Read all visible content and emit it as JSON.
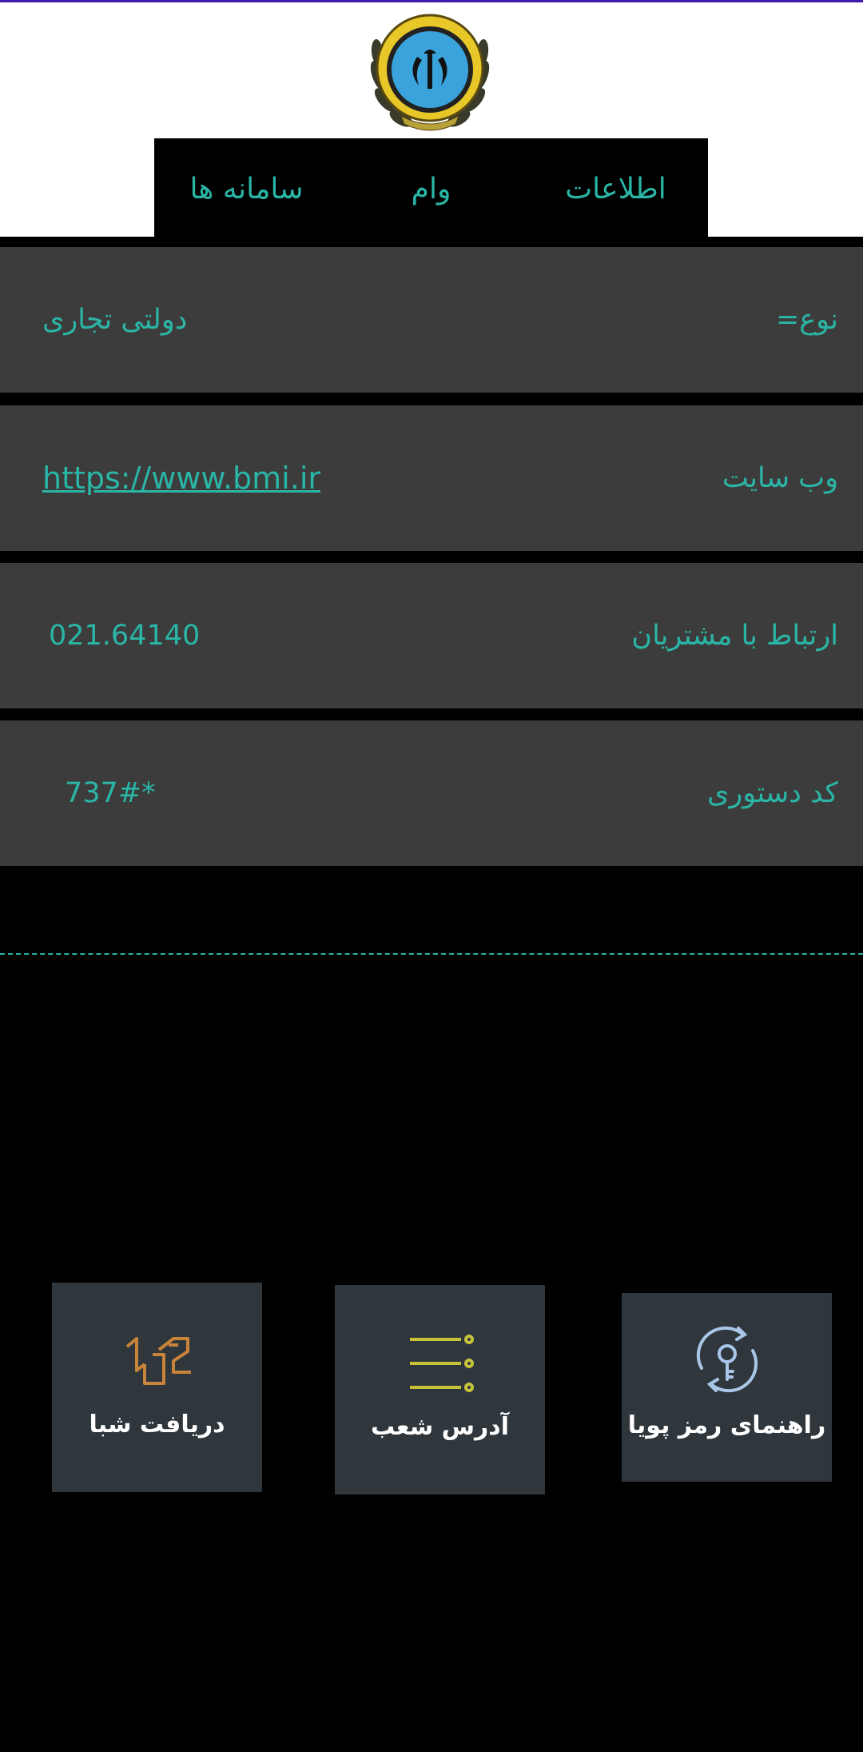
{
  "tabs": [
    {
      "label": "اطلاعات"
    },
    {
      "label": "وام"
    },
    {
      "label": "سامانه ها"
    }
  ],
  "info_rows": [
    {
      "label": "نوع=",
      "value": "دولتی تجاری"
    },
    {
      "label": "وب سایت",
      "value": "https://www.bmi.ir"
    },
    {
      "label": "ارتباط با مشتریان",
      "value": "021.64140"
    },
    {
      "label": "کد دستوری",
      "value": "*737#"
    }
  ],
  "cards": [
    {
      "label": "دریافت شبا",
      "icon": "sheba-icon"
    },
    {
      "label": "آدرس شعب",
      "icon": "list-icon"
    },
    {
      "label": "راهنمای رمز پویا",
      "icon": "dynamic-password-icon"
    }
  ],
  "colors": {
    "accent": "#2ab6a6",
    "row_bg": "#3c3c3c",
    "card_bg": "#2f373d",
    "status_bar": "#3f1aa8"
  }
}
